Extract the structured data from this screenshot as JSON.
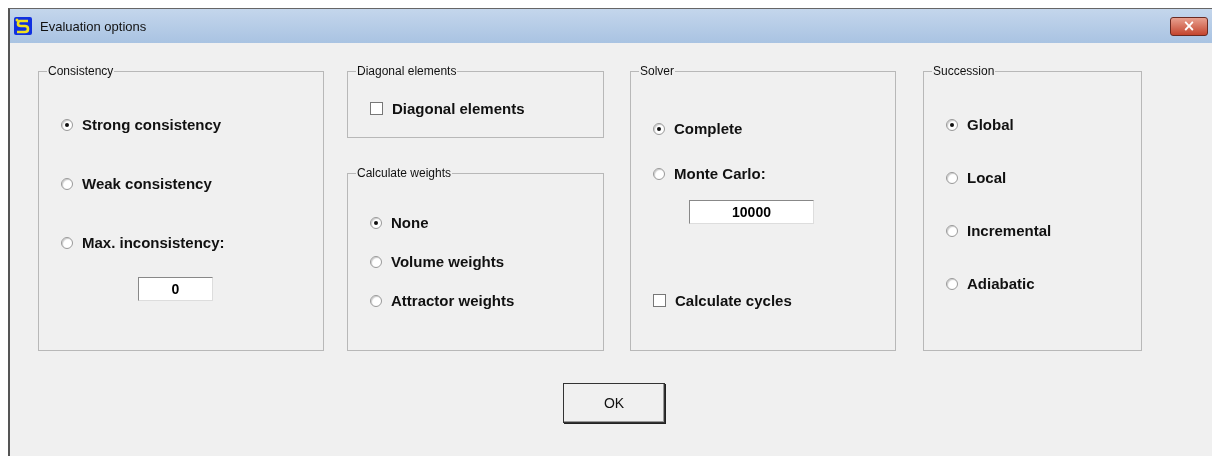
{
  "window": {
    "title": "Evaluation options",
    "close": "×"
  },
  "columns": [
    {
      "groups": [
        {
          "title": "Consistency",
          "items": [
            {
              "kind": "radio",
              "label": "Strong consistency",
              "selected": true
            },
            {
              "kind": "radio",
              "label": "Weak consistency",
              "selected": false
            },
            {
              "kind": "radio",
              "label": "Max. inconsistency:",
              "selected": false
            },
            {
              "kind": "field",
              "value": "0"
            }
          ]
        }
      ]
    },
    {
      "groups": [
        {
          "title": "Diagonal elements",
          "items": [
            {
              "kind": "checkbox",
              "label": "Diagonal elements",
              "checked": false
            }
          ]
        },
        {
          "title": "Calculate weights",
          "items": [
            {
              "kind": "radio",
              "label": "None",
              "selected": true
            },
            {
              "kind": "radio",
              "label": "Volume weights",
              "selected": false
            },
            {
              "kind": "radio",
              "label": "Attractor weights",
              "selected": false
            }
          ]
        }
      ]
    },
    {
      "groups": [
        {
          "title": "Solver",
          "items": [
            {
              "kind": "radio",
              "label": "Complete",
              "selected": true
            },
            {
              "kind": "radio",
              "label": "Monte Carlo:",
              "selected": false
            },
            {
              "kind": "field",
              "value": "10000"
            },
            {
              "kind": "checkbox",
              "label": "Calculate cycles",
              "checked": false
            }
          ]
        }
      ]
    },
    {
      "groups": [
        {
          "title": "Succession",
          "items": [
            {
              "kind": "radio",
              "label": "Global",
              "selected": true
            },
            {
              "kind": "radio",
              "label": "Local",
              "selected": false
            },
            {
              "kind": "radio",
              "label": "Incremental",
              "selected": false
            },
            {
              "kind": "radio",
              "label": "Adiabatic",
              "selected": false
            }
          ]
        }
      ]
    }
  ],
  "ok_button": "OK"
}
